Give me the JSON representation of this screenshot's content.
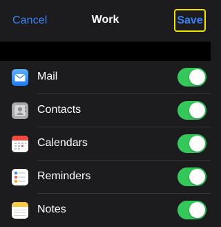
{
  "nav": {
    "cancel_label": "Cancel",
    "title": "Work",
    "save_label": "Save"
  },
  "accent_color": "#3a82f7",
  "highlight_color": "#f2e600",
  "toggle_on_color": "#34c759",
  "services": [
    {
      "label": "Mail",
      "icon": "mail-icon",
      "enabled": true
    },
    {
      "label": "Contacts",
      "icon": "contacts-icon",
      "enabled": true
    },
    {
      "label": "Calendars",
      "icon": "calendar-icon",
      "enabled": true
    },
    {
      "label": "Reminders",
      "icon": "reminders-icon",
      "enabled": true
    },
    {
      "label": "Notes",
      "icon": "notes-icon",
      "enabled": true
    }
  ]
}
